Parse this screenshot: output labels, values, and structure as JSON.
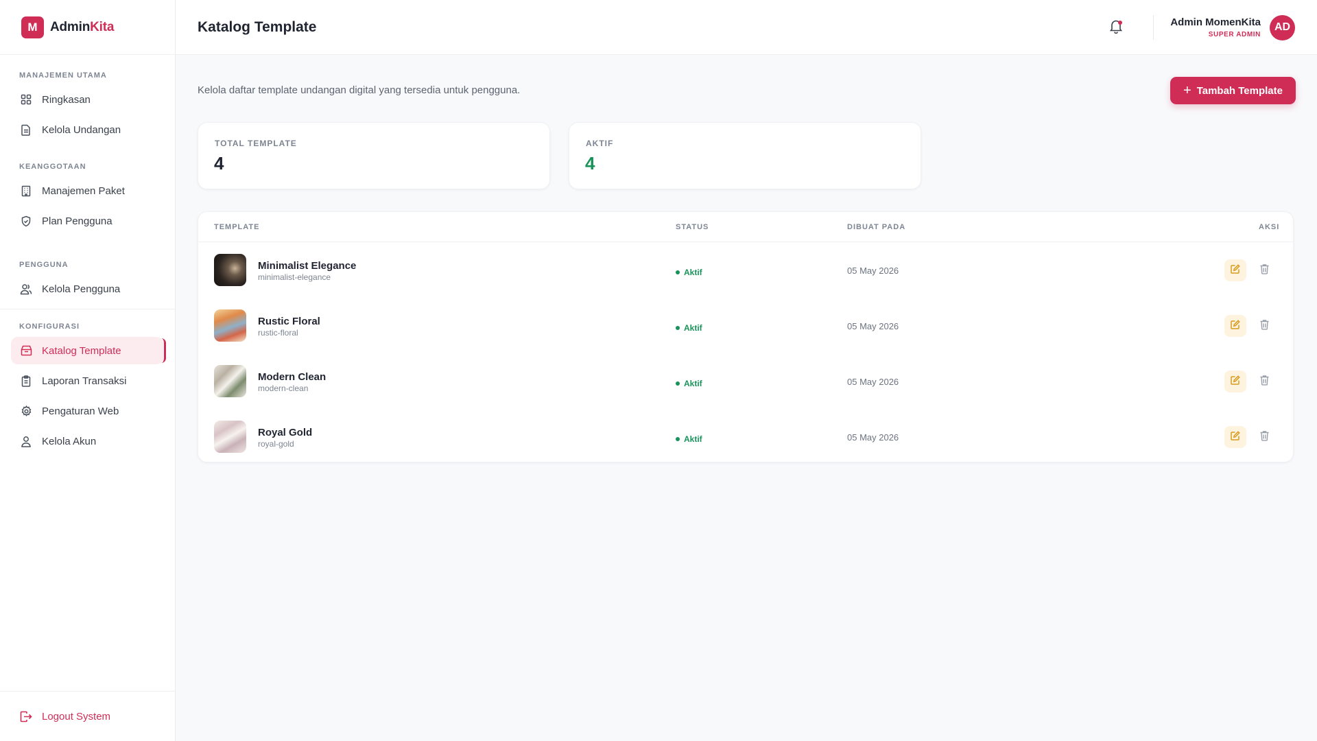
{
  "brand": {
    "logo_letter": "M",
    "name_part1": "Admin",
    "name_part2": "Kita"
  },
  "sidebar": {
    "sections": [
      {
        "heading": "MANAJEMEN UTAMA",
        "items": [
          {
            "label": "Ringkasan",
            "icon": "grid-icon"
          },
          {
            "label": "Kelola Undangan",
            "icon": "document-icon"
          }
        ]
      },
      {
        "heading": "KEANGGOTAAN",
        "items": [
          {
            "label": "Manajemen Paket",
            "icon": "building-icon"
          },
          {
            "label": "Plan Pengguna",
            "icon": "shield-check-icon"
          }
        ]
      },
      {
        "heading": "PENGGUNA",
        "items": [
          {
            "label": "Kelola Pengguna",
            "icon": "users-icon"
          }
        ]
      },
      {
        "heading": "KONFIGURASI",
        "items": [
          {
            "label": "Katalog Template",
            "icon": "tray-icon",
            "active": true
          },
          {
            "label": "Laporan Transaksi",
            "icon": "clipboard-icon"
          },
          {
            "label": "Pengaturan Web",
            "icon": "gear-icon"
          },
          {
            "label": "Kelola Akun",
            "icon": "user-icon"
          }
        ]
      }
    ],
    "logout_label": "Logout System"
  },
  "header": {
    "title": "Katalog Template",
    "user_name": "Admin MomenKita",
    "user_role": "SUPER ADMIN",
    "avatar_initials": "AD"
  },
  "main": {
    "description": "Kelola daftar template undangan digital yang tersedia untuk pengguna.",
    "add_button_label": "Tambah Template",
    "stats": [
      {
        "label": "TOTAL TEMPLATE",
        "value": "4"
      },
      {
        "label": "AKTIF",
        "value": "4"
      }
    ],
    "table": {
      "columns": [
        "TEMPLATE",
        "STATUS",
        "DIBUAT PADA",
        "AKSI"
      ],
      "rows": [
        {
          "name": "Minimalist Elegance",
          "slug": "minimalist-elegance",
          "status": "Aktif",
          "date": "05 May 2026"
        },
        {
          "name": "Rustic Floral",
          "slug": "rustic-floral",
          "status": "Aktif",
          "date": "05 May 2026"
        },
        {
          "name": "Modern Clean",
          "slug": "modern-clean",
          "status": "Aktif",
          "date": "05 May 2026"
        },
        {
          "name": "Royal Gold",
          "slug": "royal-gold",
          "status": "Aktif",
          "date": "05 May 2026"
        }
      ]
    }
  },
  "colors": {
    "accent": "#cf2d56",
    "success": "#17935a",
    "edit_bg": "#fdf3df",
    "edit_icon": "#d99a1c"
  }
}
